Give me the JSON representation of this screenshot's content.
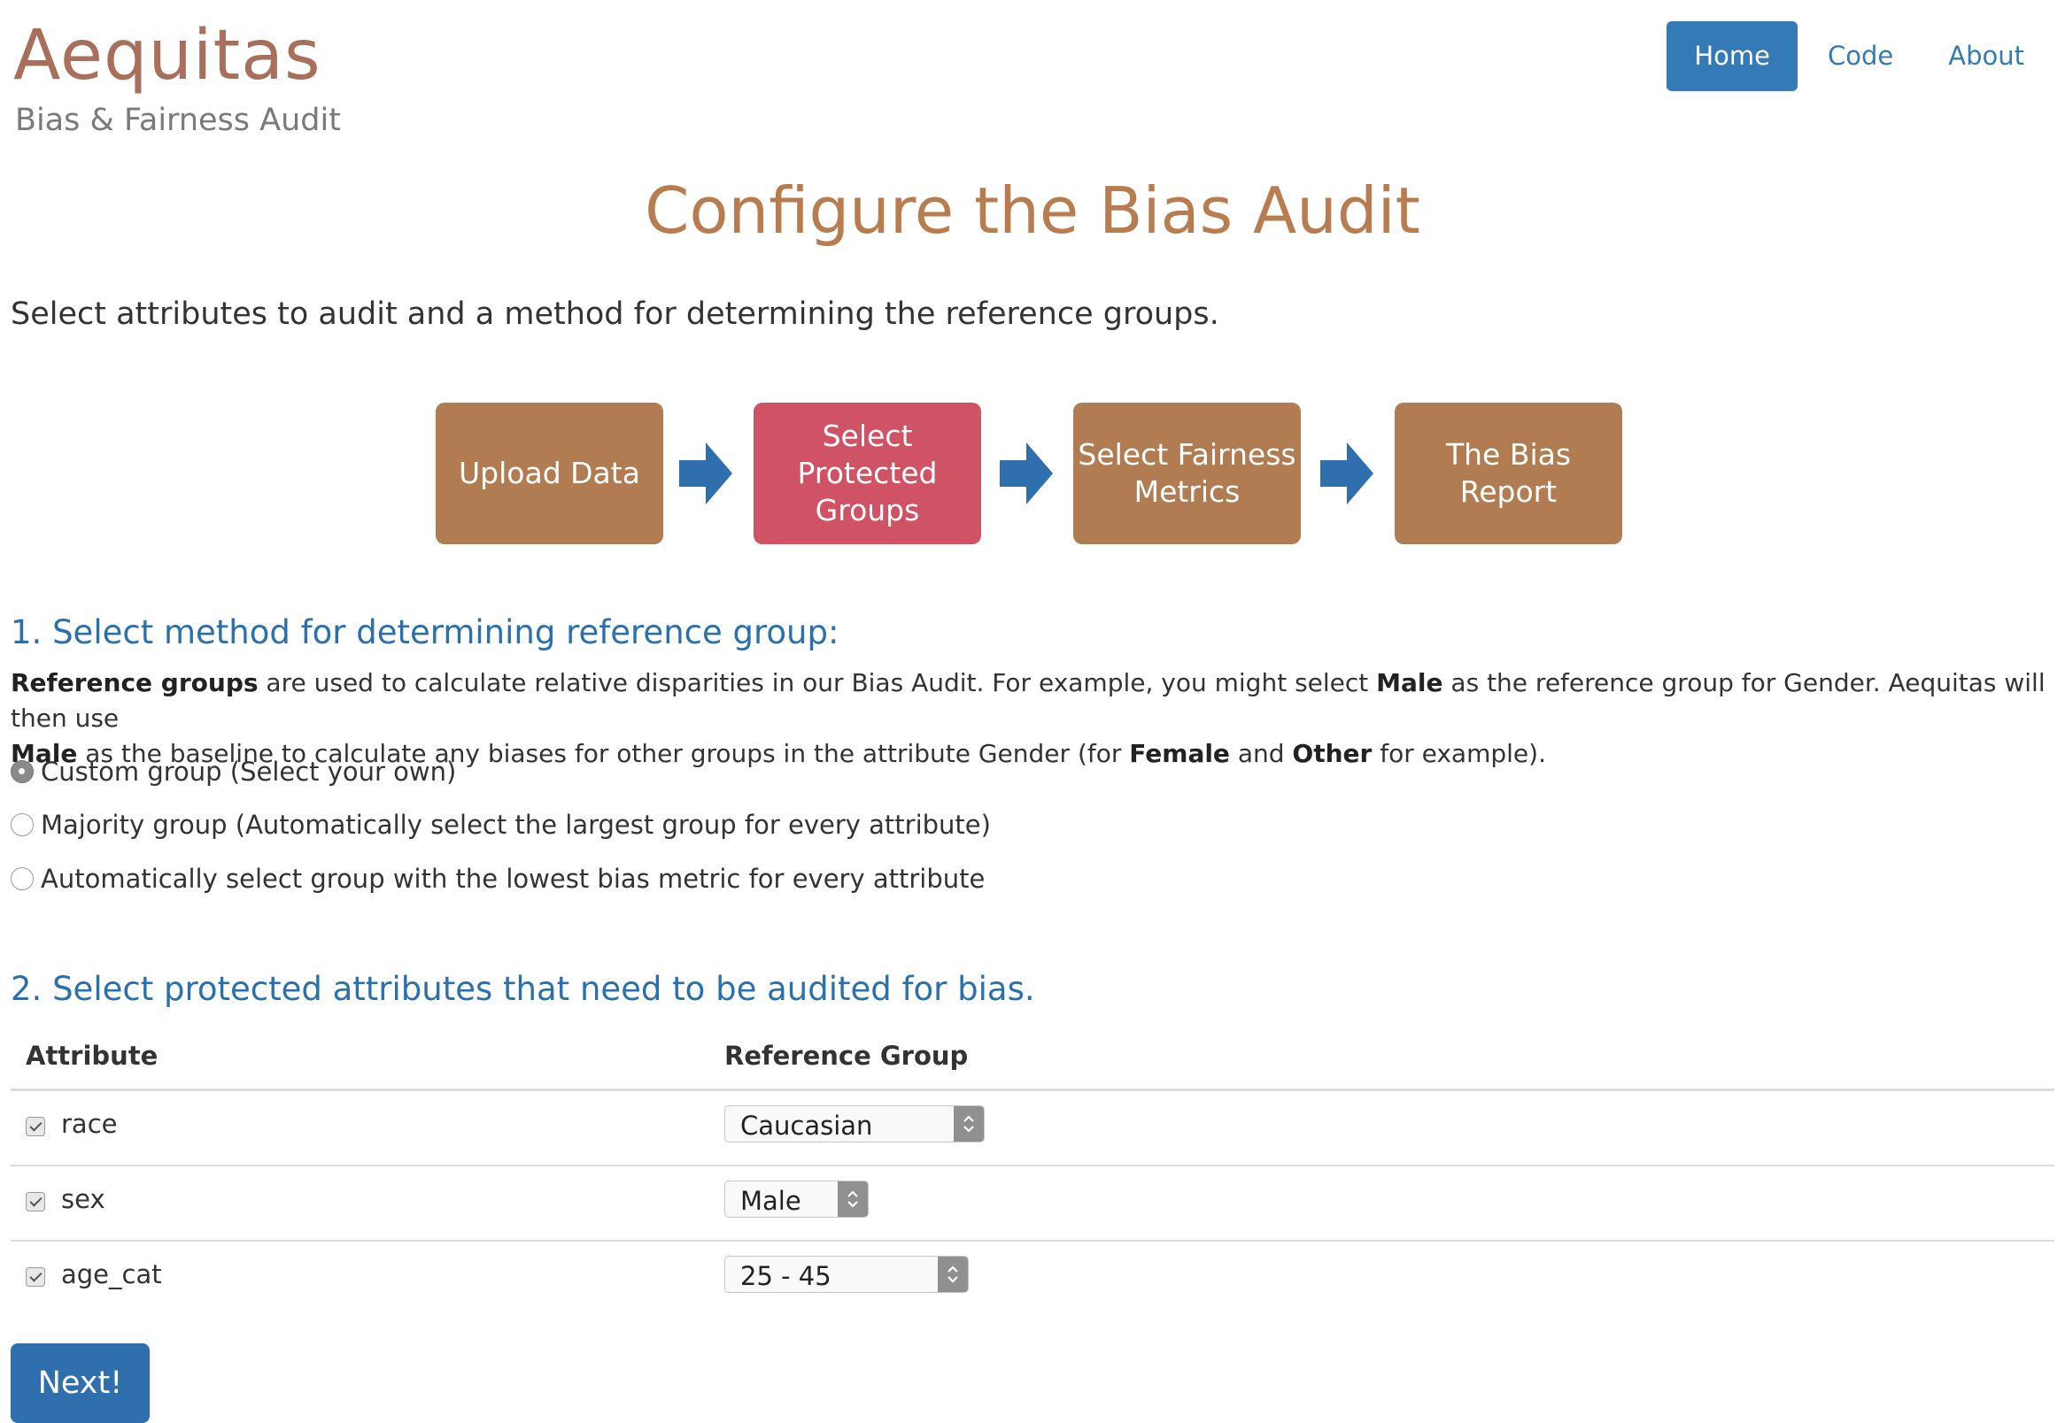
{
  "brand": {
    "title": "Aequitas",
    "subtitle": "Bias & Fairness Audit"
  },
  "nav": {
    "home": "Home",
    "code": "Code",
    "about": "About"
  },
  "page": {
    "title": "Configure the Bias Audit",
    "intro": "Select attributes to audit and a method for determining the reference groups."
  },
  "workflow": {
    "steps": [
      {
        "label": "Upload Data",
        "state": "default"
      },
      {
        "label": "Select Protected Groups",
        "state": "current"
      },
      {
        "label": "Select Fairness Metrics",
        "state": "default"
      },
      {
        "label": "The Bias Report",
        "state": "default"
      }
    ]
  },
  "section1": {
    "heading": "1. Select method for determining reference group:",
    "desc_parts": [
      "Reference groups",
      " are used to calculate relative disparities in our Bias Audit. For example, you might select ",
      "Male",
      " as the reference group for Gender. Aequitas will then use ",
      "Male",
      " as the baseline to calculate any biases for other groups in the attribute Gender (for ",
      "Female",
      " and ",
      "Other",
      " for example)."
    ],
    "options": [
      {
        "label": "Custom group (Select your own)",
        "checked": true
      },
      {
        "label": "Majority group (Automatically select the largest group for every attribute)",
        "checked": false
      },
      {
        "label": "Automatically select group with the lowest bias metric for every attribute",
        "checked": false
      }
    ]
  },
  "section2": {
    "heading": "2. Select protected attributes that need to be audited for bias.",
    "columns": {
      "attribute": "Attribute",
      "reference_group": "Reference Group"
    },
    "rows": [
      {
        "attribute": "race",
        "checked": true,
        "reference_group": "Caucasian"
      },
      {
        "attribute": "sex",
        "checked": true,
        "reference_group": "Male"
      },
      {
        "attribute": "age_cat",
        "checked": true,
        "reference_group": "25 - 45"
      }
    ]
  },
  "actions": {
    "next": "Next!"
  },
  "colors": {
    "brand": "#a8705a",
    "link": "#337ab7",
    "heading": "#2a6fae",
    "title": "#b87c4f",
    "step": "#b17c52",
    "step_current": "#cf5364",
    "arrow": "#2f6fae"
  }
}
